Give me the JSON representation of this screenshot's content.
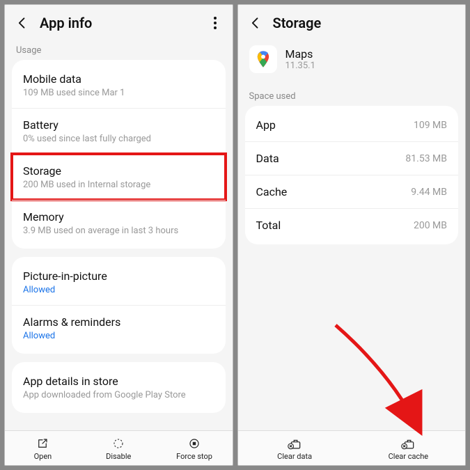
{
  "left": {
    "title": "App info",
    "section_usage": "Usage",
    "items_usage": [
      {
        "title": "Mobile data",
        "sub": "109 MB used since Mar 1"
      },
      {
        "title": "Battery",
        "sub": "0% used since last fully charged"
      },
      {
        "title": "Storage",
        "sub": "200 MB used in Internal storage",
        "hl": true
      },
      {
        "title": "Memory",
        "sub": "3.9 MB used on average in last 3 hours"
      }
    ],
    "items_perm": [
      {
        "title": "Picture-in-picture",
        "sub": "Allowed",
        "link": true
      },
      {
        "title": "Alarms & reminders",
        "sub": "Allowed",
        "link": true
      }
    ],
    "items_store": [
      {
        "title": "App details in store",
        "sub": "App downloaded from Google Play Store"
      }
    ],
    "footer": [
      {
        "label": "Open"
      },
      {
        "label": "Disable"
      },
      {
        "label": "Force stop"
      }
    ]
  },
  "right": {
    "title": "Storage",
    "app": {
      "name": "Maps",
      "version": "11.35.1"
    },
    "section_space": "Space used",
    "rows": [
      {
        "label": "App",
        "value": "109 MB"
      },
      {
        "label": "Data",
        "value": "81.53 MB"
      },
      {
        "label": "Cache",
        "value": "9.44 MB"
      },
      {
        "label": "Total",
        "value": "200 MB"
      }
    ],
    "footer": [
      {
        "label": "Clear data"
      },
      {
        "label": "Clear cache"
      }
    ]
  }
}
